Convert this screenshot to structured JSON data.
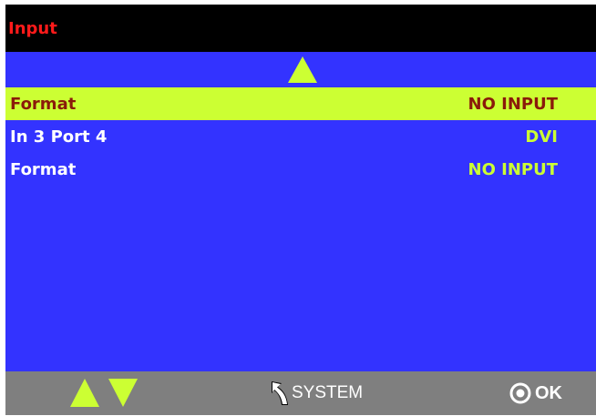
{
  "header": {
    "title": "Input"
  },
  "rows": [
    {
      "label": "Format",
      "value": "NO INPUT",
      "selected": true
    },
    {
      "label": "In 3 Port 4",
      "value": "DVI",
      "selected": false
    },
    {
      "label": "Format",
      "value": "NO INPUT",
      "selected": false
    }
  ],
  "scroll": {
    "up_icon": "triangle-up-icon"
  },
  "footer": {
    "nav_icons": [
      "triangle-up-icon",
      "triangle-down-icon"
    ],
    "back_icon": "return-arrow-icon",
    "back_label": "SYSTEM",
    "ok_icon": "circle-dot-icon",
    "ok_label": "OK"
  },
  "colors": {
    "background": "#3333ff",
    "title_bar": "#000000",
    "title_text": "#ff1a1a",
    "highlight": "#ccff33",
    "highlight_text": "#8a1a0a",
    "footer": "#7f7f7f"
  }
}
